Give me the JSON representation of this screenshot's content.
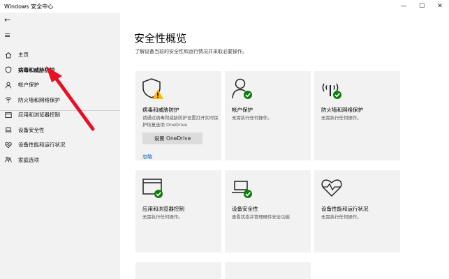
{
  "window": {
    "title": "Windows 安全中心",
    "minimize_glyph": "—",
    "maximize_glyph": "☐",
    "close_glyph": "✕"
  },
  "sidebar": {
    "back_glyph": "←",
    "menu_glyph": "≡",
    "items": [
      {
        "label": "主页",
        "icon": "home-icon"
      },
      {
        "label": "病毒和威胁防护",
        "icon": "shield-icon"
      },
      {
        "label": "帐户保护",
        "icon": "person-icon"
      },
      {
        "label": "防火墙和网络保护",
        "icon": "wifi-icon"
      },
      {
        "label": "应用和浏览器控制",
        "icon": "app-window-icon"
      },
      {
        "label": "设备安全性",
        "icon": "laptop-icon"
      },
      {
        "label": "设备性能和运行状况",
        "icon": "heart-icon"
      },
      {
        "label": "家庭选项",
        "icon": "family-icon"
      }
    ]
  },
  "main": {
    "title": "安全性概览",
    "subtitle": "了解设备当前的安全性和运行情况并采取必要操作。",
    "cards": [
      {
        "title": "病毒和威胁防护",
        "desc": "请通过病毒和威胁防护设置打开实时保护恢复选项 OneDrive",
        "button": "设置 OneDrive",
        "link": "忽略",
        "status": "warning"
      },
      {
        "title": "帐户保护",
        "desc": "无需执行任何操作。",
        "status": "ok"
      },
      {
        "title": "防火墙和网络保护",
        "desc": "无需执行任何操作。",
        "status": "ok"
      },
      {
        "title": "应用和浏览器控制",
        "desc": "无需执行任何操作。",
        "status": "ok"
      },
      {
        "title": "设备安全性",
        "desc": "查看状态并管理硬件安全功能",
        "status": "ok"
      },
      {
        "title": "设备性能和运行状况",
        "desc": "无需执行任何操作。",
        "status": "ok"
      }
    ]
  },
  "colors": {
    "accent": "#0063b1",
    "ok": "#107c10",
    "warning": "#ffb900",
    "annotation": "#e81123"
  }
}
